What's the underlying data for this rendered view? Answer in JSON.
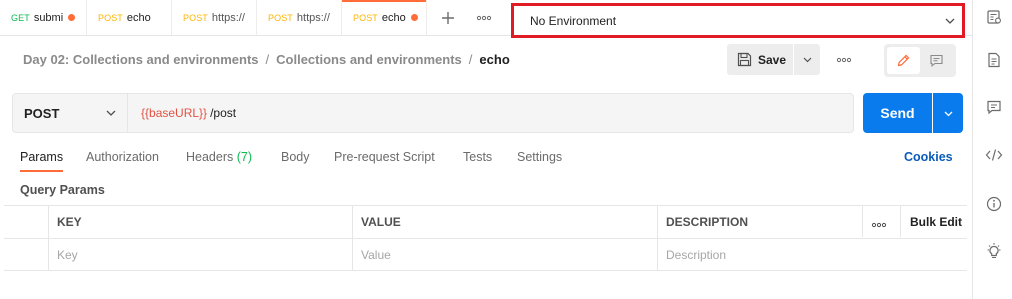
{
  "tabs": [
    {
      "method": "GET",
      "name": "submi",
      "unsaved": true
    },
    {
      "method": "POST",
      "name": "echo",
      "unsaved": false
    },
    {
      "method": "POST",
      "name": "https://",
      "unsaved": false
    },
    {
      "method": "POST",
      "name": "https://",
      "unsaved": false
    },
    {
      "method": "POST",
      "name": "echo",
      "unsaved": true,
      "active": true
    }
  ],
  "environment": {
    "selected": "No Environment"
  },
  "breadcrumb": {
    "workspace": "Day 02: Collections and environments",
    "collection": "Collections and environments",
    "request": "echo",
    "separator": "/"
  },
  "toolbar": {
    "save_label": "Save"
  },
  "request": {
    "method": "POST",
    "url_variable": "{{baseURL}}",
    "url_path": "/post",
    "send_label": "Send"
  },
  "request_tabs": {
    "params": "Params",
    "authorization": "Authorization",
    "headers": "Headers",
    "headers_count": "(7)",
    "body": "Body",
    "prerequest": "Pre-request Script",
    "tests": "Tests",
    "settings": "Settings",
    "cookies": "Cookies"
  },
  "query_params": {
    "title": "Query Params",
    "headers": {
      "key": "KEY",
      "value": "VALUE",
      "description": "DESCRIPTION",
      "bulk_edit": "Bulk Edit"
    },
    "placeholders": {
      "key": "Key",
      "value": "Value",
      "description": "Description"
    }
  },
  "colors": {
    "accent": "#ff6c37",
    "send": "#097bed",
    "get": "#0cbb52",
    "post": "#ffb400",
    "highlight_border": "#e01b24",
    "variable": "#e05243",
    "link": "#0b5bb9"
  },
  "icons": {
    "new_tab": "plus-icon",
    "more_tabs": "more-horizontal-icon",
    "env_dropdown": "chevron-down-icon",
    "save": "save-icon",
    "edit": "pencil-icon",
    "comments": "comment-icon",
    "rail": [
      "environment-quicklook-icon",
      "documentation-icon",
      "comments-icon",
      "code-icon",
      "info-icon",
      "lightbulb-icon"
    ]
  }
}
